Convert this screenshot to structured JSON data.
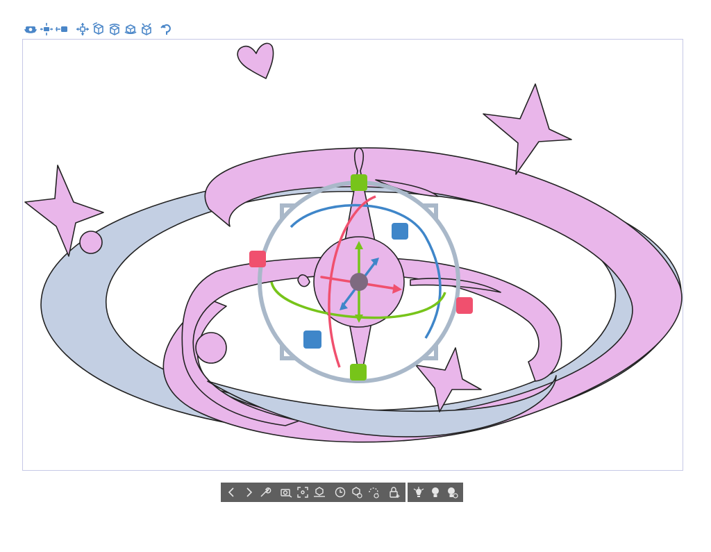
{
  "top_toolbar": {
    "icons": [
      "camera-rotate-icon",
      "camera-pan-icon",
      "camera-dolly-icon",
      "move-object-icon",
      "rotate-object-icon",
      "orbit-object-icon",
      "tilt-object-icon",
      "flip-object-icon",
      "undo-rotate-icon"
    ],
    "accent": "#4a86c8"
  },
  "canvas": {
    "background": "#ffffff",
    "border": "#c6c8e6",
    "shape_colors": {
      "pink": "#e9b6ea",
      "blue_gray": "#c3cfe3",
      "outline": "#222222"
    },
    "manipulator_colors": {
      "ring": "#a9b8c9",
      "x_axis": "#f0506e",
      "y_axis": "#77c41a",
      "z_axis": "#3f86c9",
      "center": "#7e6a80"
    }
  },
  "bottom_bar": {
    "group1": [
      "prev-icon",
      "next-icon",
      "wrench-icon",
      "camera-icon",
      "fit-view-icon",
      "ground-icon",
      "reset-pose-icon",
      "reset-object-icon",
      "reset-rotation-icon",
      "lock-icon"
    ],
    "group2": [
      "light-icon",
      "light-source-icon",
      "light-settings-icon"
    ],
    "background": "#5f5f5f"
  }
}
